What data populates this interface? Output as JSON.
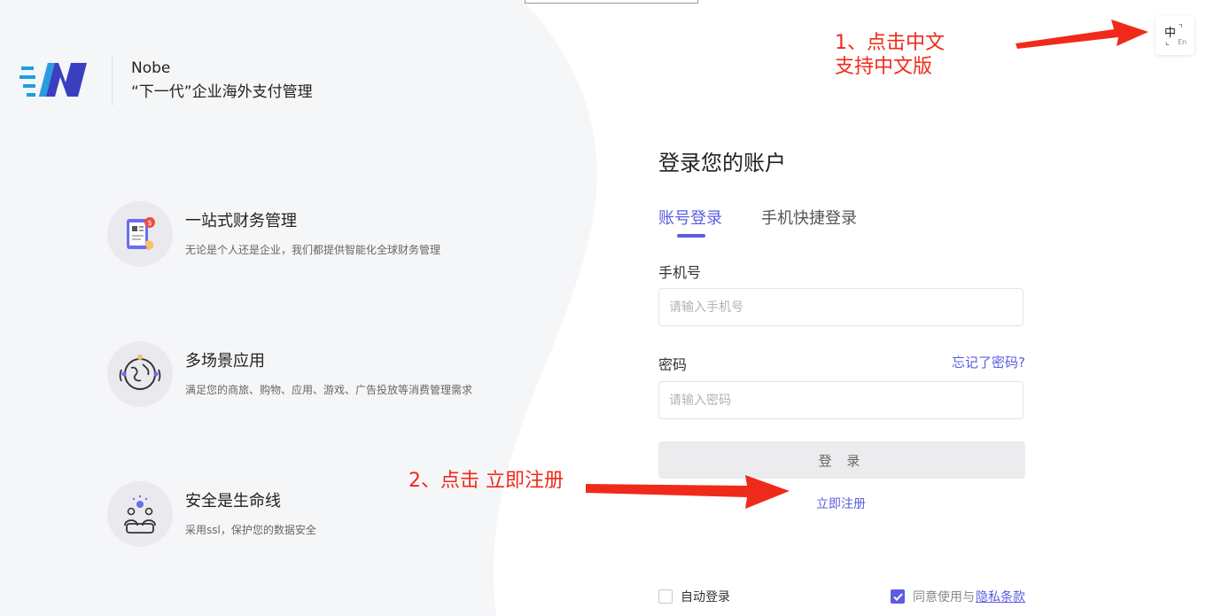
{
  "brand": {
    "name": "Nobe",
    "slogan": "“下一代”企业海外支付管理"
  },
  "features": [
    {
      "icon": "finance-phone-icon",
      "title": "一站式财务管理",
      "desc": "无论是个人还是企业，我们都提供智能化全球财务管理"
    },
    {
      "icon": "globe-scenes-icon",
      "title": "多场景应用",
      "desc": "满足您的商旅、购物、应用、游戏、广告投放等消费管理需求"
    },
    {
      "icon": "security-people-icon",
      "title": "安全是生命线",
      "desc": "采用ssl，保护您的数据安全"
    }
  ],
  "lang_toggle": {
    "zh": "中",
    "en": "En"
  },
  "annotations": {
    "step1_line1": "1、点击中文",
    "step1_line2": "支持中文版",
    "step2": "2、点击 立即注册"
  },
  "login": {
    "title": "登录您的账户",
    "tabs": [
      {
        "label": "账号登录",
        "active": true
      },
      {
        "label": "手机快捷登录",
        "active": false
      }
    ],
    "phone_label": "手机号",
    "phone_placeholder": "请输入手机号",
    "password_label": "密码",
    "password_placeholder": "请输入密码",
    "forgot": "忘记了密码?",
    "submit": "登 录",
    "register": "立即注册",
    "auto_login": "自动登录",
    "agree_prefix": "同意使用与",
    "privacy_link": "隐私条款",
    "agree_checked": true,
    "auto_login_checked": false
  },
  "colors": {
    "accent": "#5b5ce2",
    "annotation": "#f02a1a",
    "left_panel": "#f5f6f8"
  }
}
